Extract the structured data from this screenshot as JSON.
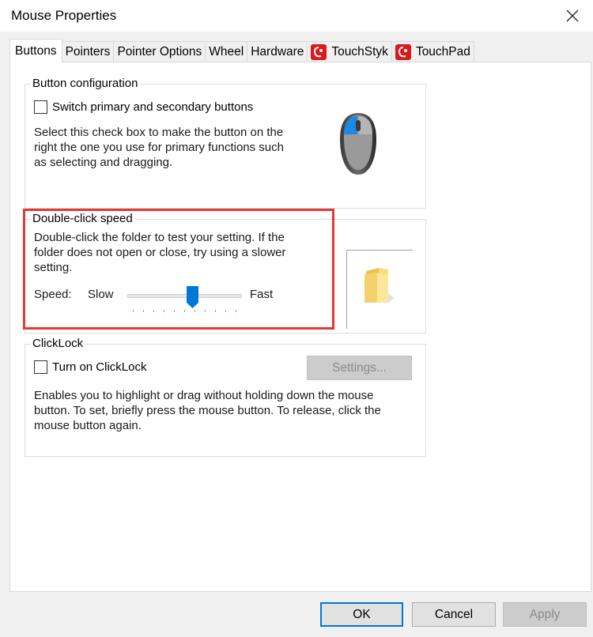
{
  "window": {
    "title": "Mouse Properties"
  },
  "tabs": [
    {
      "label": "Buttons",
      "active": true
    },
    {
      "label": "Pointers"
    },
    {
      "label": "Pointer Options"
    },
    {
      "label": "Wheel"
    },
    {
      "label": "Hardware"
    },
    {
      "label": "TouchStyk",
      "icon": "touchstyk-icon"
    },
    {
      "label": "TouchPad",
      "icon": "touchpad-icon"
    }
  ],
  "button_configuration": {
    "group_label": "Button configuration",
    "checkbox_label": "Switch primary and secondary buttons",
    "checked": false,
    "description": "Select this check box to make the button on the right the one you use for primary functions such as selecting and dragging.",
    "description_lines": [
      "Select this check box to make the button on the",
      "right the one you use for primary functions such",
      "as selecting and dragging."
    ]
  },
  "double_click": {
    "group_label": "Double-click speed",
    "description_lines": [
      "Double-click the folder to test your setting. If the",
      "folder does not open or close, try using a slower",
      "setting."
    ],
    "speed_label": "Speed:",
    "slow_label": "Slow",
    "fast_label": "Fast",
    "slider_position": 0.58,
    "tick_count": 11
  },
  "clicklock": {
    "group_label": "ClickLock",
    "checkbox_label": "Turn on ClickLock",
    "checked": false,
    "settings_button": "Settings...",
    "description_lines": [
      "Enables you to highlight or drag without holding down the mouse",
      "button. To set, briefly press the mouse button. To release, click the",
      "mouse button again."
    ]
  },
  "footer": {
    "ok": "OK",
    "cancel": "Cancel",
    "apply": "Apply"
  },
  "colors": {
    "accent": "#0078d7",
    "highlight": "#e53935",
    "brand_red": "#d9181f"
  }
}
